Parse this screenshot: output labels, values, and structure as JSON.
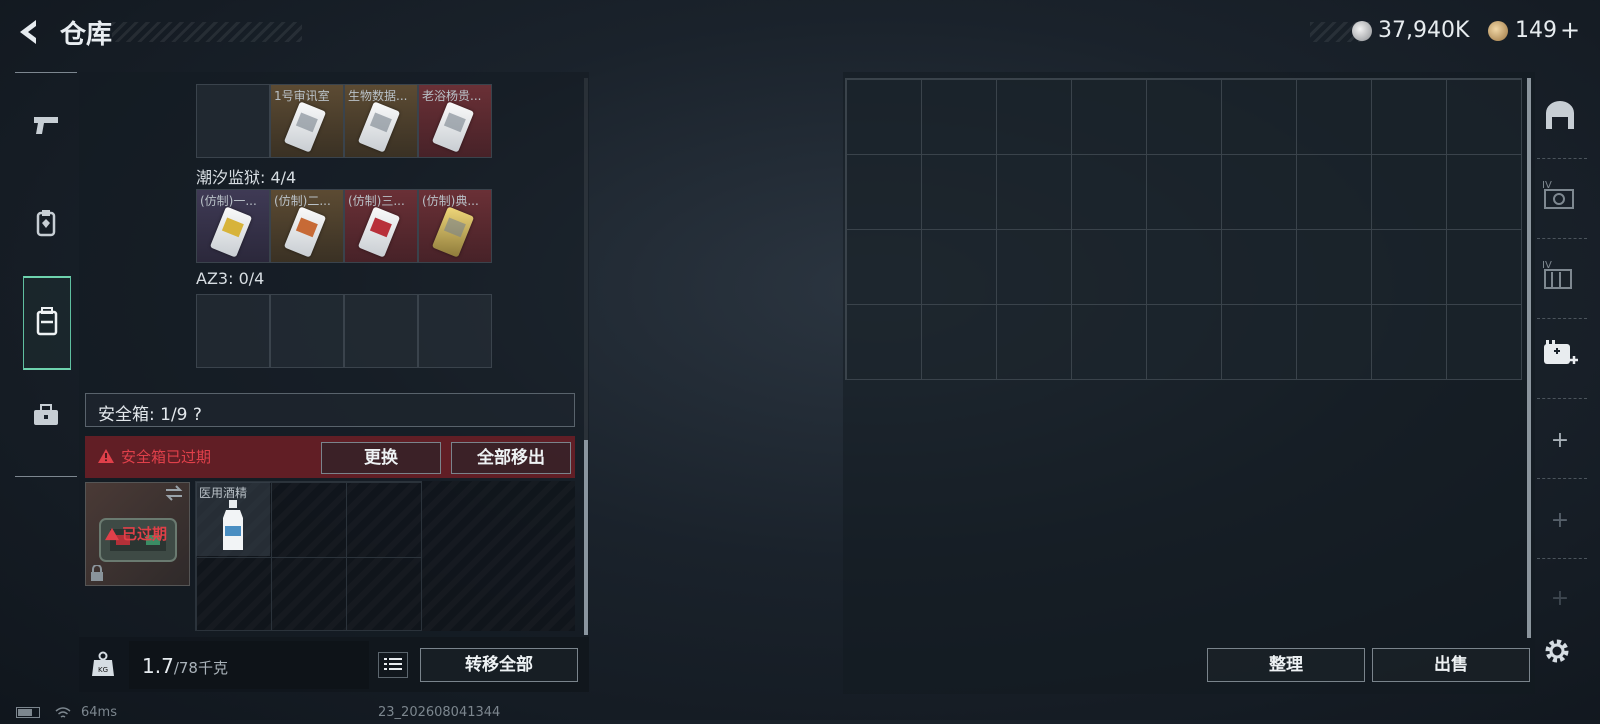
{
  "header": {
    "title": "仓库",
    "currency_silver": "37,940K",
    "currency_gold": "149",
    "gold_plus": "+"
  },
  "left_rail": {
    "items": [
      "pistol-icon",
      "armor-icon",
      "backpack-icon",
      "toolbox-icon"
    ],
    "active": "backpack-icon"
  },
  "key_rows": {
    "row1": [
      {
        "label": "",
        "tone": "empty"
      },
      {
        "label": "1号审讯室",
        "tone": "bronze"
      },
      {
        "label": "生物数据...",
        "tone": "bronze"
      },
      {
        "label": "老浴杨贵...",
        "tone": "red"
      }
    ],
    "section2_title": "潮汐监狱: 4/4",
    "row2": [
      {
        "label": "(仿制)一...",
        "tone": "purple"
      },
      {
        "label": "(仿制)二...",
        "tone": "bronze"
      },
      {
        "label": "(仿制)三...",
        "tone": "red"
      },
      {
        "label": "(仿制)典...",
        "tone": "red"
      }
    ],
    "section3_title": "AZ3: 0/4"
  },
  "safe_box": {
    "title": "安全箱: 1/9 ?",
    "warning": "安全箱已过期",
    "replace_button": "更换",
    "remove_all_button": "全部移出",
    "expired_tag": "已过期",
    "item_label": "医用酒精"
  },
  "bottom_left": {
    "weight": "1.7",
    "weight_max": "/78千克",
    "transfer_all": "转移全部"
  },
  "right_panel": {
    "sort_button": "整理",
    "sell_button": "出售",
    "add1": "+",
    "add2": "+",
    "add3": "+"
  },
  "status_bar": {
    "ping": "64ms",
    "build": "23_202608041344"
  },
  "colors": {
    "accent": "#6ed3ae",
    "warning": "#e0404a",
    "warning_bg": "#6e1e26"
  }
}
